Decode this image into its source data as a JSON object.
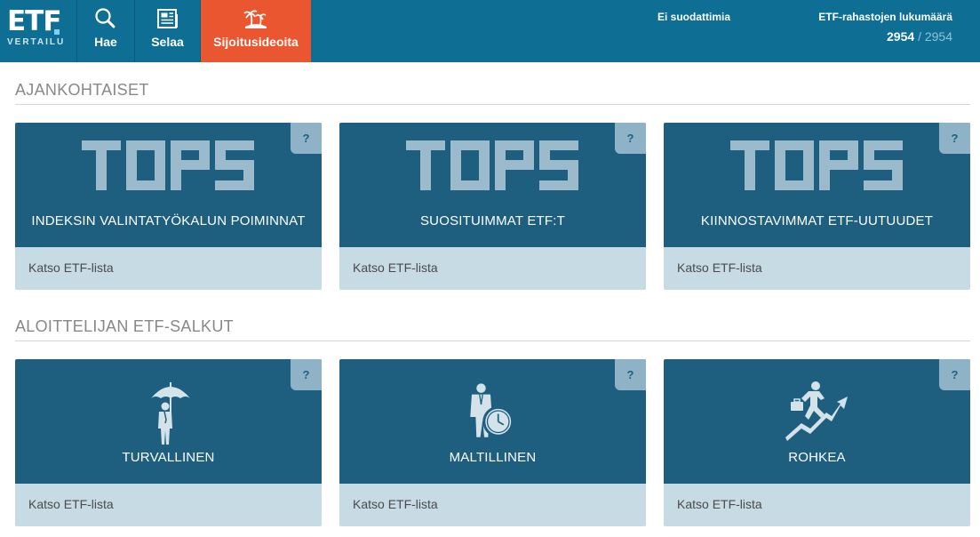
{
  "header": {
    "logo_main": "ETF",
    "logo_sub": "VERTAILU",
    "nav": [
      {
        "label": "Hae",
        "icon": "search-icon"
      },
      {
        "label": "Selaa",
        "icon": "newspaper-icon"
      },
      {
        "label": "Sijoitusideoita",
        "icon": "palm-island-icon",
        "active": true
      }
    ],
    "filter_status": "Ei suodattimia",
    "fund_count_label": "ETF-rahastojen lukumäärä",
    "fund_count_filtered": "2954",
    "fund_count_separator": "/",
    "fund_count_total": "2954"
  },
  "colors": {
    "header_bg": "#0e6e94",
    "active_tab": "#e9562f",
    "card_top": "#1e5f80",
    "card_bottom": "#c7dbe4",
    "help_badge": "#8fb3c6"
  },
  "sections": [
    {
      "title": "AJANKOHTAISET",
      "cards": [
        {
          "art_text": "TOPS",
          "title": "INDEKSIN VALINTATYÖKALUN POIMINNAT",
          "link": "Katso ETF-lista",
          "help": "?"
        },
        {
          "art_text": "TOPS",
          "title": "SUOSITUIMMAT ETF:T",
          "link": "Katso ETF-lista",
          "help": "?"
        },
        {
          "art_text": "TOPS",
          "title": "KIINNOSTAVIMMAT ETF-UUTUUDET",
          "link": "Katso ETF-lista",
          "help": "?"
        }
      ]
    },
    {
      "title": "ALOITTELIJAN ETF-SALKUT",
      "cards": [
        {
          "icon": "businessman-umbrella-icon",
          "title": "TURVALLINEN",
          "link": "Katso ETF-lista",
          "help": "?"
        },
        {
          "icon": "businessman-clock-icon",
          "title": "MALTILLINEN",
          "link": "Katso ETF-lista",
          "help": "?"
        },
        {
          "icon": "businessman-running-up-arrow-icon",
          "title": "ROHKEA",
          "link": "Katso ETF-lista",
          "help": "?"
        }
      ]
    }
  ]
}
